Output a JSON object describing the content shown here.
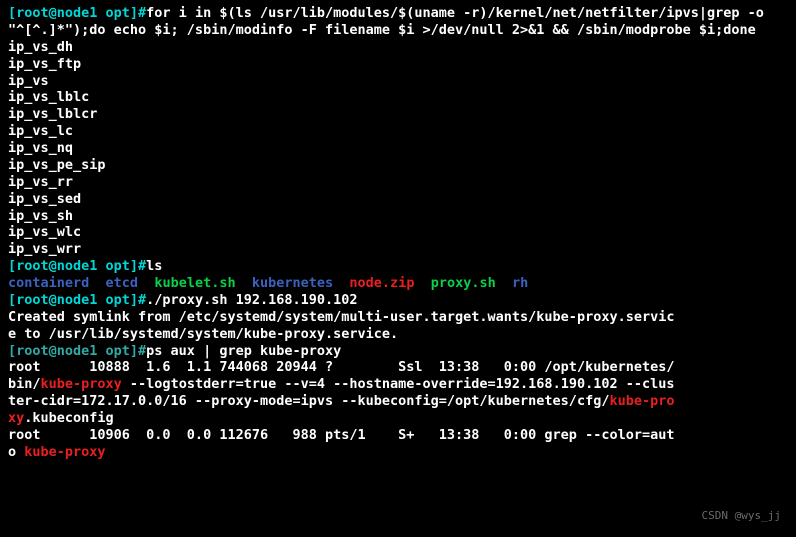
{
  "l1_prefix": "[root@node1 opt]#",
  "l1_cmd": "for i in $(ls /usr/lib/modules/$(uname -r)/kernel/net/netfilter/ipvs|grep -o \"^[^.]*\");do echo $i; /sbin/modinfo -F filename $i >/dev/null 2>&1 && /sbin/modprobe $i;done",
  "modules": [
    "ip_vs_dh",
    "ip_vs_ftp",
    "ip_vs",
    "ip_vs_lblc",
    "ip_vs_lblcr",
    "ip_vs_lc",
    "ip_vs_nq",
    "ip_vs_pe_sip",
    "ip_vs_rr",
    "ip_vs_sed",
    "ip_vs_sh",
    "ip_vs_wlc",
    "ip_vs_wrr"
  ],
  "ls_prefix": "[root@node1 opt]#",
  "ls_cmd": "ls",
  "ls_out": [
    "containerd",
    "etcd",
    "kubelet.sh",
    "kubernetes",
    "node.zip",
    "proxy.sh",
    "rh"
  ],
  "proxy_prefix": "[root@node1 opt]#",
  "proxy_cmd": "./proxy.sh 192.168.190.102",
  "symlink1": "Created symlink from /etc/systemd/system/multi-user.target.wants/kube-proxy.servic",
  "symlink2": "e to /usr/lib/systemd/system/kube-proxy.service.",
  "ps_prefix": "[root@node1 opt]#",
  "ps_cmd": "ps aux | grep kube-proxy",
  "p1a": "root      10888  1.6  1.1 744068 20944 ?        Ssl  13:38   0:00 /opt/kubernetes/",
  "p1b_1": "bin/",
  "p1b_r1": "kube-proxy",
  "p1b_2": " --logtostderr=true --v=4 --hostname-override=192.168.190.102 --clus",
  "p1c_1": "ter-cidr=172.17.0.0/16 --proxy-mode=ipvs --kubeconfig=/opt/kubernetes/cfg/",
  "p1c_r1": "kube-pro",
  "p1d_r": "xy",
  "p1d_1": ".kubeconfig",
  "p2a": "root      10906  0.0  0.0 112676   988 pts/1    S+   13:38   0:00 grep --color=aut",
  "p2b_1": "o ",
  "p2b_r": "kube-proxy",
  "watermark": "CSDN @wys_jj"
}
